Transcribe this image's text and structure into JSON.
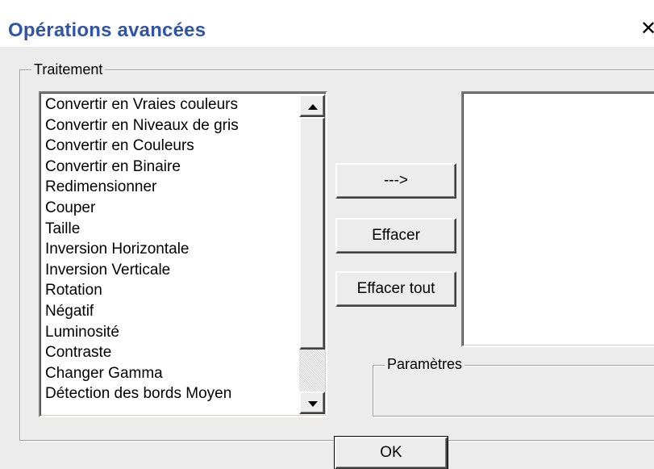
{
  "window": {
    "title": "Opérations avancées",
    "close_glyph": "✕"
  },
  "traitement": {
    "label": "Traitement",
    "items": [
      "Convertir en Vraies couleurs",
      "Convertir en Niveaux de gris",
      "Convertir en Couleurs",
      "Convertir en Binaire",
      "Redimensionner",
      "Couper",
      "Taille",
      "Inversion Horizontale",
      "Inversion Verticale",
      "Rotation",
      "Négatif",
      "Luminosité",
      "Contraste",
      "Changer Gamma",
      "Détection des bords Moyen"
    ]
  },
  "buttons": {
    "add": "--->",
    "clear": "Effacer",
    "clear_all": "Effacer tout",
    "ok": "OK"
  },
  "parametres": {
    "label": "Paramètres"
  },
  "colors": {
    "title_text": "#3154a8",
    "dialog_bg": "#ececec"
  },
  "icons": {
    "scroll_up": "triangle-up",
    "scroll_down": "triangle-down",
    "close": "x-mark"
  }
}
